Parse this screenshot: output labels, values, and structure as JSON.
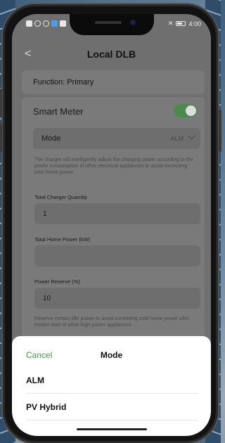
{
  "status_bar": {
    "time": "4:00"
  },
  "header": {
    "title": "Local DLB",
    "back_label": "<"
  },
  "function_row": {
    "label": "Function: Primary"
  },
  "smart_meter": {
    "label": "Smart Meter",
    "enabled": true
  },
  "mode_row": {
    "label": "Mode",
    "value": "ALM"
  },
  "mode_description": "The charger will intelligently adjust the charging power according to the power consumption of other electrical appliances to avoid exceeding total home power.",
  "fields": {
    "charger_qty": {
      "label": "Total Charger Quantity",
      "value": "1"
    },
    "home_power": {
      "label": "Total Home Power (kW)",
      "value": ""
    },
    "power_reserve": {
      "label": "Power Reserve (%)",
      "value": "10"
    }
  },
  "reserve_description": "Reserve certain idle power to avoid exceeding total home power after instant start of other high-power appliances.",
  "sheet": {
    "cancel_label": "Cancel",
    "title": "Mode",
    "options": [
      "ALM",
      "PV Hybrid"
    ]
  },
  "colors": {
    "accent_green": "#3e9b3e",
    "toggle_on": "#4e8a4e"
  }
}
